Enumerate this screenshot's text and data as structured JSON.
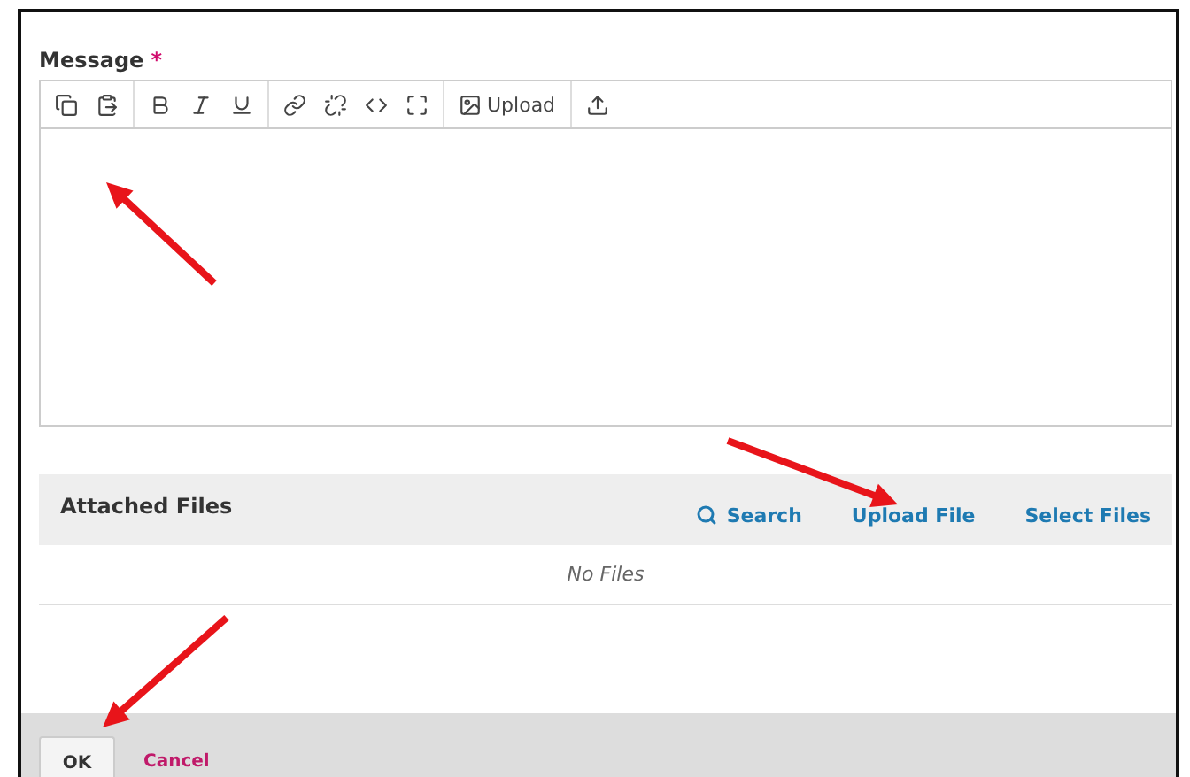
{
  "message": {
    "label": "Message",
    "required_mark": "*",
    "toolbar": {
      "upload_label": "Upload"
    }
  },
  "attached_files": {
    "title": "Attached Files",
    "actions": [
      {
        "label": "Search",
        "kind": "search"
      },
      {
        "label": "Upload File",
        "kind": "plain"
      },
      {
        "label": "Select Files",
        "kind": "plain"
      }
    ],
    "empty_text": "No Files"
  },
  "buttons": [
    {
      "label": "OK",
      "kind": "primary"
    },
    {
      "label": "Cancel",
      "kind": "link"
    }
  ]
}
